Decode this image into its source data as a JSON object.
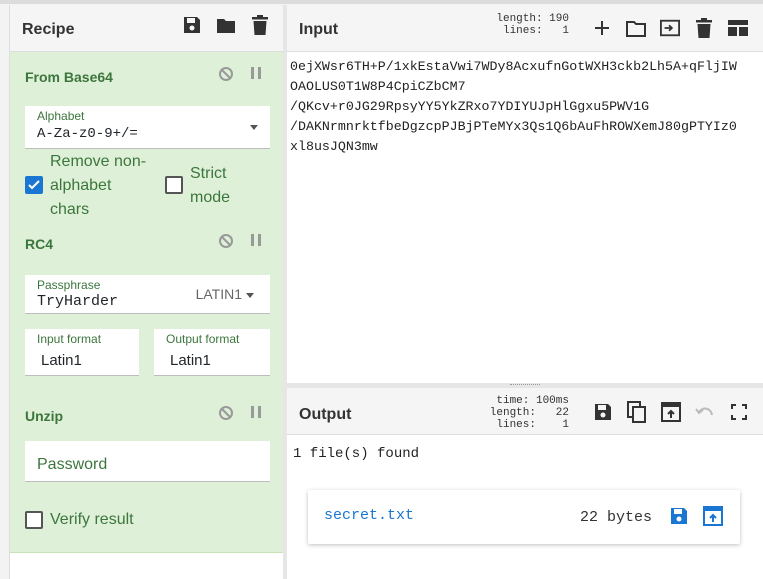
{
  "recipe": {
    "title": "Recipe",
    "header_icons": [
      "save-icon",
      "folder-icon",
      "trash-icon"
    ],
    "operations": [
      {
        "name": "From Base64",
        "alphabet_label": "Alphabet",
        "alphabet_value": "A-Za-z0-9+/=",
        "remove_non_alpha_label": "Remove non-\nalphabet\nchars",
        "remove_non_alpha_checked": true,
        "strict_mode_label": "Strict\nmode",
        "strict_mode_checked": false
      },
      {
        "name": "RC4",
        "passphrase_label": "Passphrase",
        "passphrase_value": "TryHarder",
        "passphrase_encoding": "LATIN1",
        "input_format_label": "Input format",
        "input_format_value": "Latin1",
        "output_format_label": "Output format",
        "output_format_value": "Latin1"
      },
      {
        "name": "Unzip",
        "password_placeholder": "Password",
        "verify_label": "Verify result",
        "verify_checked": false
      }
    ]
  },
  "input": {
    "title": "Input",
    "length_stat": "length: 190",
    "lines_stat": "lines:   1",
    "text": "0ejXWsr6TH+P/1xkEstaVwi7WDy8AcxufnGotWXH3ckb2Lh5A+qFljIW\nOAOLUS0T1W8P4CpiCZbCM7\n/QKcv+r0JG29RpsyYY5YkZRxo7YDIYUJpHlGgxu5PWV1G\n/DAKNrmnrktfbeDgzcpPJBjPTeMYx3Qs1Q6bAuFhROWXemJ80gPTYIz0\nxl8usJQN3mw"
  },
  "output": {
    "title": "Output",
    "time_stat": "time: 100ms",
    "length_stat": "length:   22",
    "lines_stat": "lines:    1",
    "summary": "1 file(s) found",
    "file_name": "secret.txt",
    "file_size": "22 bytes"
  },
  "colors": {
    "op_background": "#dff0d8",
    "op_text": "#3c763d",
    "accent": "#1976d2"
  }
}
